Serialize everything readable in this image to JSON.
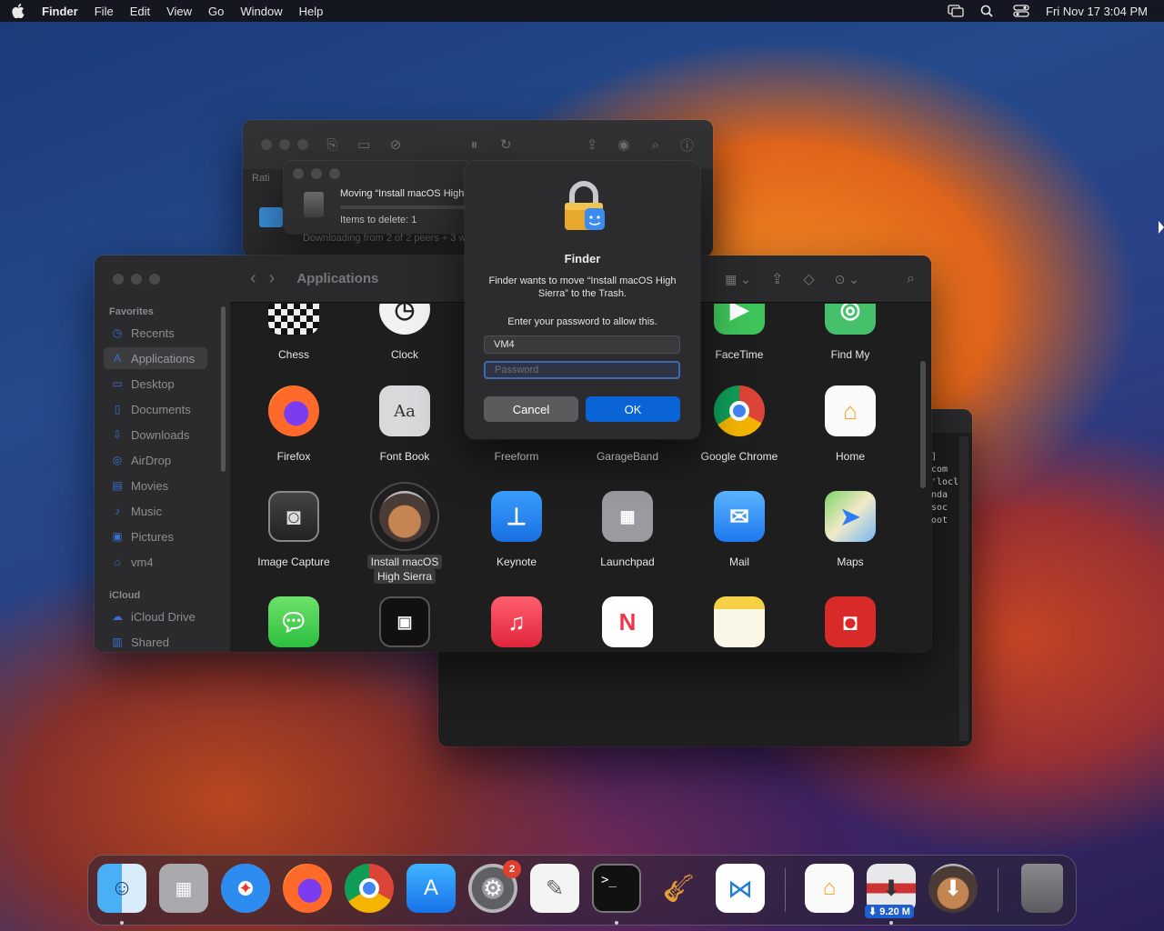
{
  "menubar": {
    "app_name": "Finder",
    "menus": [
      "File",
      "Edit",
      "View",
      "Go",
      "Window",
      "Help"
    ],
    "datetime": "Fri Nov 17  3:04 PM"
  },
  "transmission_window": {
    "sidebar_label": "Rati",
    "status_text": "Downloading from 2 of 2 peers + 3 w"
  },
  "progress_window": {
    "title": "Moving “Install macOS High Sierra”",
    "items_text": "Items to delete: 1"
  },
  "terminal_window": {
    "lines": [
      "]",
      "com",
      "",
      "'locl",
      "nda",
      "soc",
      "oot"
    ]
  },
  "finder": {
    "title": "Applications",
    "sidebar": {
      "favorites_header": "Favorites",
      "favorites": [
        "Recents",
        "Applications",
        "Desktop",
        "Documents",
        "Downloads",
        "AirDrop",
        "Movies",
        "Music",
        "Pictures",
        "vm4"
      ],
      "selected": "Applications",
      "icloud_header": "iCloud",
      "icloud": [
        "iCloud Drive",
        "Shared"
      ]
    },
    "apps": [
      {
        "name": "Chess",
        "icon": "chess-icon"
      },
      {
        "name": "Clock",
        "icon": "clock-icon"
      },
      {
        "name": "FaceTime",
        "icon": "facetime-icon"
      },
      {
        "name": "Find My",
        "icon": "findmy-icon"
      },
      {
        "name": "Firefox",
        "icon": "firefox-icon"
      },
      {
        "name": "Font Book",
        "icon": "fontbook-icon"
      },
      {
        "name": "Freeform",
        "icon": "freeform-icon"
      },
      {
        "name": "GarageBand",
        "icon": "garageband-icon"
      },
      {
        "name": "Google Chrome",
        "icon": "chrome-icon"
      },
      {
        "name": "Home",
        "icon": "home-icon"
      },
      {
        "name": "Image Capture",
        "icon": "imagecapture-icon"
      },
      {
        "name": "Install macOS High Sierra",
        "line1": "Install macOS",
        "line2": "High Sierra",
        "icon": "installer-icon"
      },
      {
        "name": "Keynote",
        "icon": "keynote-icon"
      },
      {
        "name": "Launchpad",
        "icon": "launchpad-icon"
      },
      {
        "name": "Mail",
        "icon": "mail-icon"
      },
      {
        "name": "Maps",
        "icon": "maps-icon"
      },
      {
        "name": "Messages",
        "icon": "messages-icon"
      },
      {
        "name": "Mission Control",
        "icon": "missioncontrol-icon"
      },
      {
        "name": "Music",
        "icon": "music-icon"
      },
      {
        "name": "News",
        "icon": "news-icon"
      },
      {
        "name": "Notes",
        "icon": "notes-icon"
      },
      {
        "name": "Photo Booth",
        "icon": "photobooth-icon"
      }
    ]
  },
  "auth_dialog": {
    "app_name": "Finder",
    "message": "Finder wants to move “Install macOS High Sierra” to the Trash.",
    "prompt": "Enter your password to allow this.",
    "username_value": "VM4",
    "password_placeholder": "Password",
    "cancel_label": "Cancel",
    "ok_label": "OK"
  },
  "dock": {
    "items": [
      "Finder",
      "Launchpad",
      "Safari",
      "Firefox",
      "Google Chrome",
      "App Store",
      "System Settings",
      "TextEdit",
      "Terminal",
      "GarageBand",
      "Visual Studio Code",
      "Home",
      "Transmission",
      "Install macOS High Sierra",
      "Trash"
    ],
    "settings_badge": "2",
    "download_badge": "⬇ 9.20 M"
  },
  "colors": {
    "accent": "#0a64d8",
    "badge": "#e2402f"
  }
}
